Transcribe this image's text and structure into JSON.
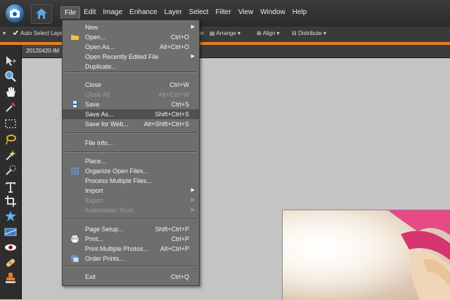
{
  "menubar": {
    "items": [
      "File",
      "Edit",
      "Image",
      "Enhance",
      "Layer",
      "Select",
      "Filter",
      "View",
      "Window",
      "Help"
    ],
    "active": "File"
  },
  "options": {
    "auto_select": "Auto Select Layer",
    "layer_label": "er",
    "arrange": "Arrange",
    "align": "Align",
    "distribute": "Distribute"
  },
  "document": {
    "tab_title": "20120420-IM"
  },
  "file_menu": {
    "items": [
      {
        "label": "New",
        "shortcut": "",
        "submenu": true,
        "disabled": false,
        "icon": ""
      },
      {
        "label": "Open...",
        "shortcut": "Ctrl+O",
        "submenu": false,
        "disabled": false,
        "icon": "folder-icon"
      },
      {
        "label": "Open As...",
        "shortcut": "Alt+Ctrl+O",
        "submenu": false,
        "disabled": false,
        "icon": ""
      },
      {
        "label": "Open Recently Edited File",
        "shortcut": "",
        "submenu": true,
        "disabled": false,
        "icon": ""
      },
      {
        "label": "Duplicate...",
        "shortcut": "",
        "submenu": false,
        "disabled": false,
        "icon": ""
      },
      {
        "label": "Close",
        "shortcut": "Ctrl+W",
        "submenu": false,
        "disabled": false,
        "icon": ""
      },
      {
        "label": "Close All",
        "shortcut": "Alt+Ctrl+W",
        "submenu": false,
        "disabled": true,
        "icon": ""
      },
      {
        "label": "Save",
        "shortcut": "Ctrl+S",
        "submenu": false,
        "disabled": false,
        "icon": "floppy-icon"
      },
      {
        "label": "Save As...",
        "shortcut": "Shift+Ctrl+S",
        "submenu": false,
        "disabled": false,
        "icon": ""
      },
      {
        "label": "Save for Web...",
        "shortcut": "Alt+Shift+Ctrl+S",
        "submenu": false,
        "disabled": false,
        "icon": ""
      },
      {
        "label": "File Info...",
        "shortcut": "",
        "submenu": false,
        "disabled": false,
        "icon": ""
      },
      {
        "label": "Place...",
        "shortcut": "",
        "submenu": false,
        "disabled": false,
        "icon": ""
      },
      {
        "label": "Organize Open Files...",
        "shortcut": "",
        "submenu": false,
        "disabled": false,
        "icon": "grid-icon"
      },
      {
        "label": "Process Multiple Files...",
        "shortcut": "",
        "submenu": false,
        "disabled": false,
        "icon": ""
      },
      {
        "label": "Import",
        "shortcut": "",
        "submenu": true,
        "disabled": false,
        "icon": ""
      },
      {
        "label": "Export",
        "shortcut": "",
        "submenu": true,
        "disabled": true,
        "icon": ""
      },
      {
        "label": "Automation Tools",
        "shortcut": "",
        "submenu": true,
        "disabled": true,
        "icon": ""
      },
      {
        "label": "Page Setup...",
        "shortcut": "Shift+Ctrl+P",
        "submenu": false,
        "disabled": false,
        "icon": ""
      },
      {
        "label": "Print...",
        "shortcut": "Ctrl+P",
        "submenu": false,
        "disabled": false,
        "icon": "printer-icon"
      },
      {
        "label": "Print Multiple Photos...",
        "shortcut": "Alt+Ctrl+P",
        "submenu": false,
        "disabled": false,
        "icon": ""
      },
      {
        "label": "Order Prints...",
        "shortcut": "",
        "submenu": false,
        "disabled": false,
        "icon": "order-prints-icon"
      },
      {
        "label": "Exit",
        "shortcut": "Ctrl+Q",
        "submenu": false,
        "disabled": false,
        "icon": ""
      }
    ],
    "hover_label": "Save As..."
  },
  "tools": [
    "move-tool-icon",
    "zoom-tool-icon",
    "hand-tool-icon",
    "eyedropper-tool-icon",
    "marquee-tool-icon",
    "lasso-tool-icon",
    "magic-wand-tool-icon",
    "quick-selection-tool-icon",
    "type-tool-icon",
    "crop-tool-icon",
    "cookie-cutter-tool-icon",
    "straighten-tool-icon",
    "red-eye-tool-icon",
    "healing-brush-tool-icon",
    "stamp-tool-icon"
  ],
  "colors": {
    "accent": "#e6801e",
    "menu_bg": "#6e6e6e",
    "hover_bg": "#505050",
    "canvas_bg": "#c4c4c4"
  }
}
